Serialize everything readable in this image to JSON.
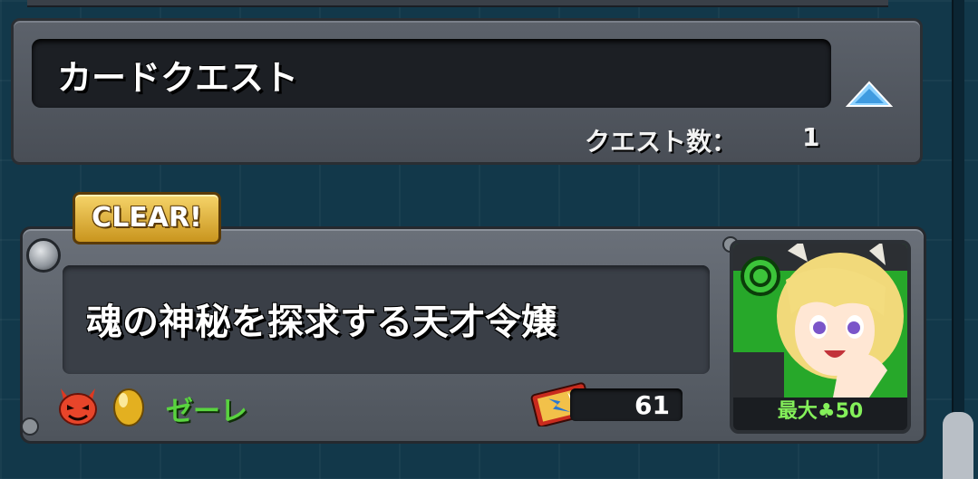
{
  "header": {
    "title": "カードクエスト",
    "quest_count_label": "クエスト数：",
    "quest_count_value": "1"
  },
  "card": {
    "clear_badge": "CLEAR!",
    "title": "魂の神秘を探求する天才令嬢",
    "monster_name": "ゼーレ",
    "ticket_count": "61",
    "max_luck_label": "最大",
    "max_luck_value": "50"
  },
  "icons": {
    "collapse": "triangle-up-icon",
    "element": "dark-element-devil-icon",
    "egg": "golden-egg-icon",
    "ticket": "card-ticket-icon",
    "clover": "clover-icon"
  },
  "colors": {
    "accent_blue": "#8fd3ff",
    "clear_gold": "#f6d46a",
    "monster_name_green": "#59d43f",
    "luck_green": "#84f05a"
  }
}
